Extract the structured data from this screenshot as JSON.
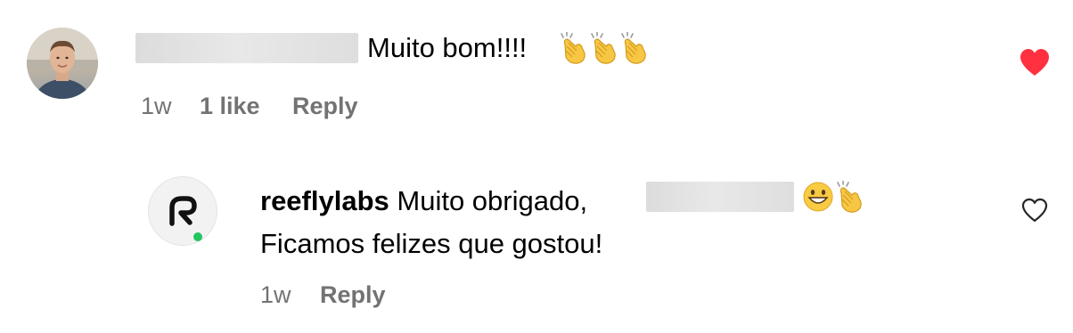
{
  "comment": {
    "text": "Muito bom!!!!",
    "emoji": [
      "clapping-hands",
      "clapping-hands",
      "clapping-hands"
    ],
    "time": "1w",
    "likes": "1 like",
    "reply_label": "Reply",
    "liked": true
  },
  "reply": {
    "username": "reeflylabs",
    "text_line1": "Muito obrigado,",
    "text_line2": "Ficamos felizes que gostou!",
    "emoji": [
      "grinning-face",
      "clapping-hands"
    ],
    "time": "1w",
    "reply_label": "Reply",
    "liked": false
  },
  "colors": {
    "like_red": "#ff3040",
    "meta_gray": "#737373",
    "brand_green": "#22c55e"
  }
}
